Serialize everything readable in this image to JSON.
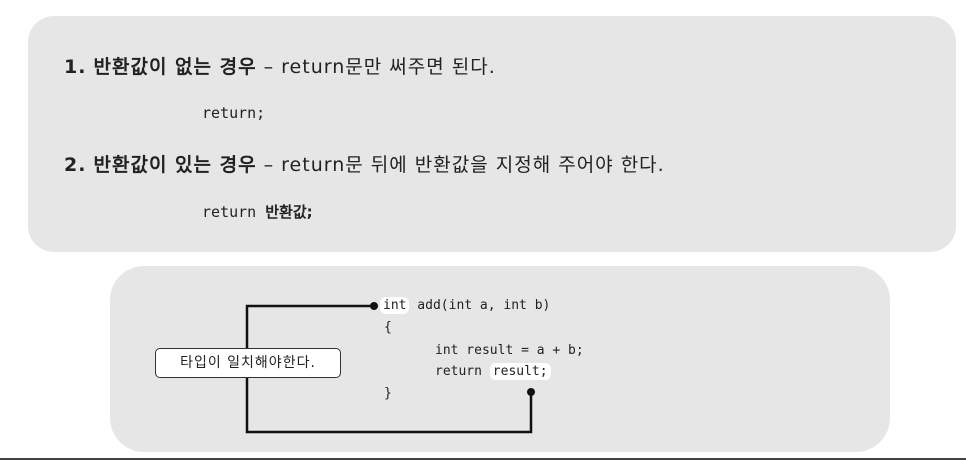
{
  "rule1": {
    "number": "1.",
    "bold": "반환값이 없는 경우",
    "text": " – return문만 써주면 된다.",
    "code": "return;"
  },
  "rule2": {
    "number": "2.",
    "bold": "반환값이 있는 경우",
    "text": " – return문 뒤에 반환값을 지정해 주어야 한다.",
    "code_keyword": "return ",
    "code_value": "반환값;"
  },
  "example": {
    "line1_type": "int",
    "line1_rest": " add(int a, int b)",
    "line2": "{",
    "line3": "int result = a + b;",
    "line4_keyword": "return ",
    "line4_value": "result;",
    "line5": "}",
    "callout": "타입이 일치해야한다."
  }
}
